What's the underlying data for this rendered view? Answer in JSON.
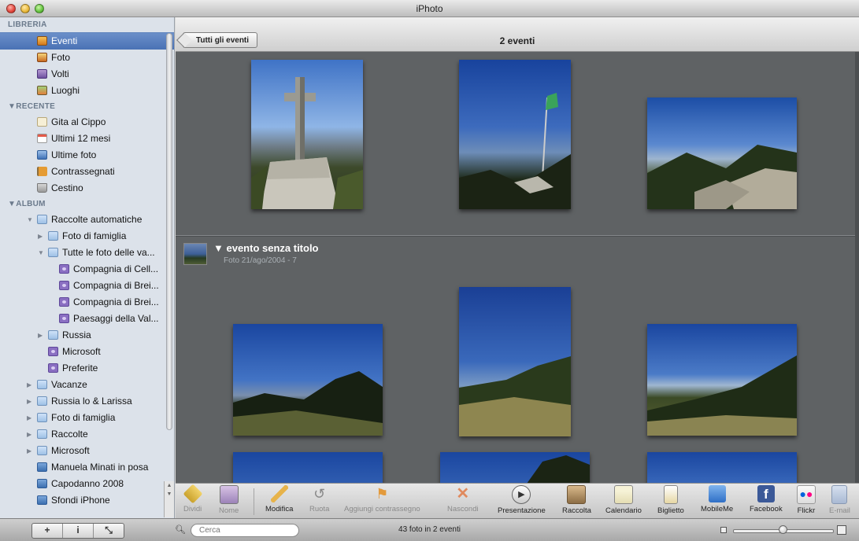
{
  "window": {
    "title": "iPhoto"
  },
  "sidebar": {
    "sections": {
      "library": "LIBRERIA",
      "recent": "▼RECENTE",
      "album": "▼ALBUM"
    },
    "library_items": [
      {
        "label": "Eventi",
        "icon": "events-icon",
        "selected": true
      },
      {
        "label": "Foto",
        "icon": "photos-icon"
      },
      {
        "label": "Volti",
        "icon": "faces-icon"
      },
      {
        "label": "Luoghi",
        "icon": "places-icon"
      }
    ],
    "recent_items": [
      {
        "label": "Gita al Cippo",
        "icon": "event-icon"
      },
      {
        "label": "Ultimi 12 mesi",
        "icon": "calendar-icon"
      },
      {
        "label": "Ultime foto",
        "icon": "import-icon"
      },
      {
        "label": "Contrassegnati",
        "icon": "flag-icon"
      },
      {
        "label": "Cestino",
        "icon": "trash-icon"
      }
    ],
    "album_items": [
      {
        "label": "Raccolte automatiche",
        "icon": "folder-icon",
        "indent": 1,
        "disclosure": "open"
      },
      {
        "label": "Foto di famiglia",
        "icon": "folder-icon",
        "indent": 2,
        "disclosure": "closed"
      },
      {
        "label": "Tutte le foto delle va...",
        "icon": "folder-icon",
        "indent": 2,
        "disclosure": "open"
      },
      {
        "label": "Compagnia di Cell...",
        "icon": "smart-album-icon",
        "indent": 3
      },
      {
        "label": "Compagnia di Brei...",
        "icon": "smart-album-icon",
        "indent": 3
      },
      {
        "label": "Compagnia di Brei...",
        "icon": "smart-album-icon",
        "indent": 3
      },
      {
        "label": "Paesaggi della Val...",
        "icon": "smart-album-icon",
        "indent": 3
      },
      {
        "label": "Russia",
        "icon": "folder-icon",
        "indent": 2,
        "disclosure": "closed"
      },
      {
        "label": "Microsoft",
        "icon": "smart-album-icon",
        "indent": 2
      },
      {
        "label": "Preferite",
        "icon": "smart-album-icon",
        "indent": 2
      },
      {
        "label": "Vacanze",
        "icon": "folder-icon",
        "indent": 1,
        "disclosure": "closed"
      },
      {
        "label": "Russia lo & Larissa",
        "icon": "folder-icon",
        "indent": 1,
        "disclosure": "closed"
      },
      {
        "label": "Foto di famiglia",
        "icon": "folder-icon",
        "indent": 1,
        "disclosure": "closed"
      },
      {
        "label": "Raccolte",
        "icon": "folder-icon",
        "indent": 1,
        "disclosure": "closed"
      },
      {
        "label": "Microsoft",
        "icon": "folder-icon",
        "indent": 1,
        "disclosure": "closed"
      },
      {
        "label": "Manuela Minati in posa",
        "icon": "album-icon",
        "indent": 1
      },
      {
        "label": "Capodanno 2008",
        "icon": "album-icon",
        "indent": 1
      },
      {
        "label": "Sfondi iPhone",
        "icon": "album-icon",
        "indent": 1
      }
    ],
    "buttons": [
      "+",
      "i",
      "⤡"
    ]
  },
  "header": {
    "back_button": "Tutti gli eventi",
    "title": "2 eventi"
  },
  "event": {
    "title": "▼ evento senza titolo",
    "subtitle": "Foto 21/ago/2004 - 7"
  },
  "toolbar": [
    {
      "label": "Dividi",
      "icon": "split-icon",
      "enabled": false
    },
    {
      "label": "Nome",
      "icon": "name-icon",
      "enabled": false
    },
    {
      "label": "Modifica",
      "icon": "pencil-icon",
      "enabled": true
    },
    {
      "label": "Ruota",
      "icon": "rotate-icon",
      "enabled": false
    },
    {
      "label": "Aggiungi contrassegno",
      "icon": "flag-icon",
      "enabled": false
    },
    {
      "label": "Nascondi",
      "icon": "hide-icon",
      "enabled": false
    },
    {
      "label": "Presentazione",
      "icon": "play-icon",
      "enabled": true
    },
    {
      "label": "Raccolta",
      "icon": "book-icon",
      "enabled": true
    },
    {
      "label": "Calendario",
      "icon": "calendar-icon",
      "enabled": true
    },
    {
      "label": "Biglietto",
      "icon": "card-icon",
      "enabled": true
    },
    {
      "label": "MobileMe",
      "icon": "cloud-icon",
      "enabled": true
    },
    {
      "label": "Facebook",
      "icon": "facebook-icon",
      "enabled": true
    },
    {
      "label": "Flickr",
      "icon": "flickr-icon",
      "enabled": true
    },
    {
      "label": "E-mail",
      "icon": "email-icon",
      "enabled": false
    }
  ],
  "status": {
    "search_placeholder": "Cerca",
    "count": "43 foto in 2 eventi",
    "zoom_level": 0.5
  },
  "colors": {
    "selection": "#4a72b5",
    "content_bg": "#5f6264",
    "facebook": "#3b5998",
    "flickr_pink": "#ff0084",
    "flickr_blue": "#0063dc"
  }
}
